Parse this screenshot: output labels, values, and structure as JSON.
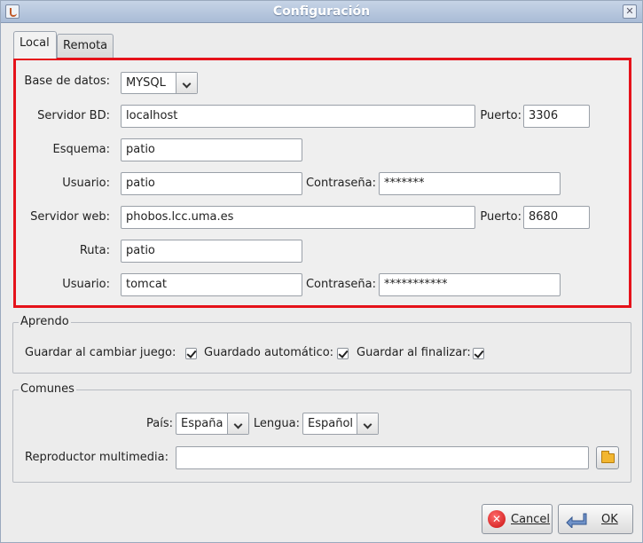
{
  "window": {
    "title": "Configuración"
  },
  "tabs": {
    "local": "Local",
    "remota": "Remota"
  },
  "local": {
    "db_label": "Base de datos:",
    "db_value": "MYSQL",
    "server_bd_label": "Servidor BD:",
    "server_bd_value": "localhost",
    "port_label": "Puerto:",
    "port_value": "3306",
    "schema_label": "Esquema:",
    "schema_value": "patio",
    "user_label": "Usuario:",
    "user_value": "patio",
    "password_label": "Contraseña:",
    "password_value": "*******",
    "web_label": "Servidor web:",
    "web_value": "phobos.lcc.uma.es",
    "web_port_label": "Puerto:",
    "web_port_value": "8680",
    "path_label": "Ruta:",
    "path_value": "patio",
    "web_user_label": "Usuario:",
    "web_user_value": "tomcat",
    "web_password_label": "Contraseña:",
    "web_password_value": "***********"
  },
  "aprendo": {
    "legend": "Aprendo",
    "save_on_change_label": "Guardar al cambiar juego:",
    "autosave_label": "Guardado automático:",
    "save_on_finish_label": "Guardar al finalizar:",
    "save_on_change_checked": true,
    "autosave_checked": true,
    "save_on_finish_checked": true
  },
  "comunes": {
    "legend": "Comunes",
    "country_label": "País:",
    "country_value": "España",
    "language_label": "Lengua:",
    "language_value": "Español",
    "player_label": "Reproductor multimedia:",
    "player_value": ""
  },
  "buttons": {
    "cancel": "Cancel",
    "ok": "OK"
  },
  "colors": {
    "highlight_border": "#e5121a",
    "titlebar": "#a9bcd6"
  },
  "icons": [
    "app-icon",
    "close-icon",
    "chevron-down-icon",
    "folder-icon",
    "cancel-icon",
    "ok-icon"
  ]
}
